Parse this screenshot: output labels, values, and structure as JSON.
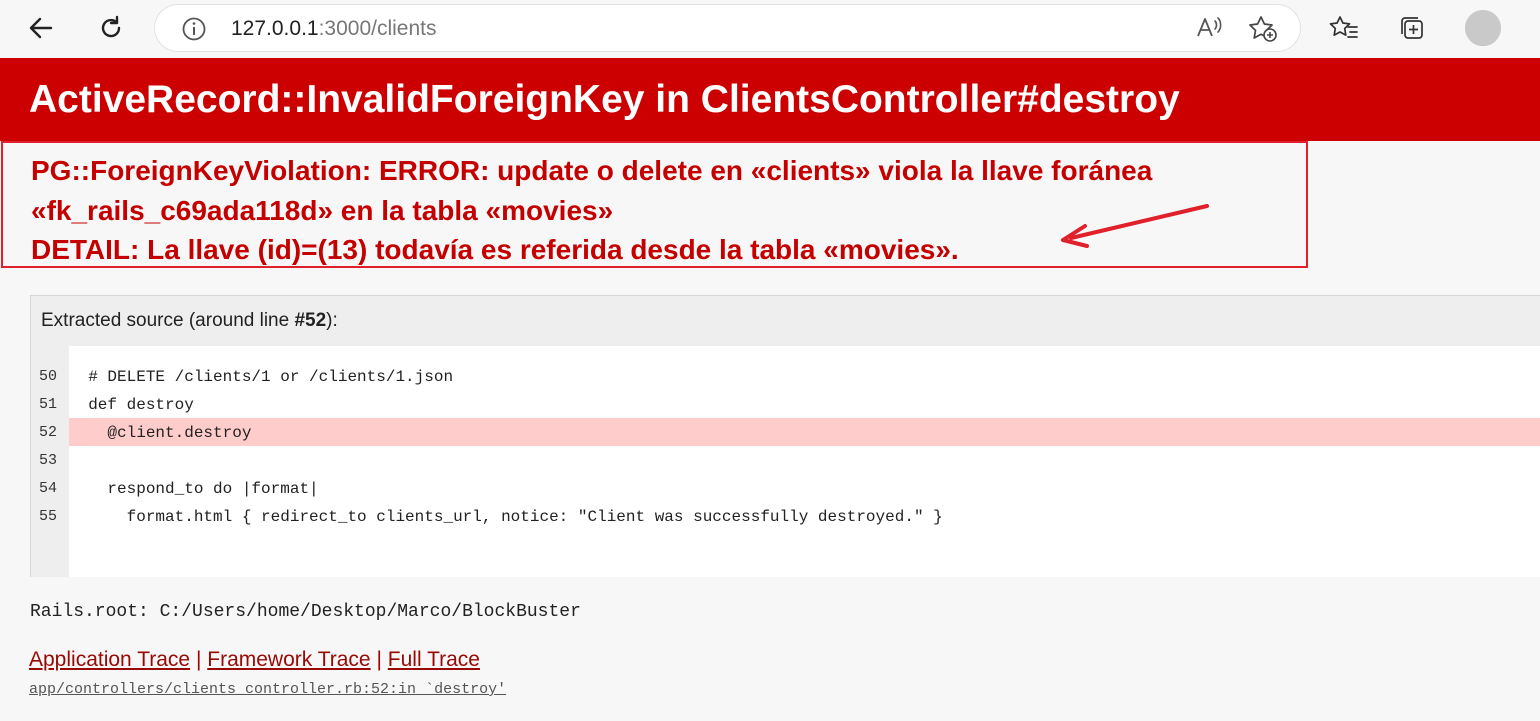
{
  "browser": {
    "url_host": "127.0.0.1",
    "url_rest": ":3000/clients"
  },
  "error": {
    "title": "ActiveRecord::InvalidForeignKey in ClientsController#destroy",
    "message_lines": [
      "PG::ForeignKeyViolation: ERROR: update o delete en «clients» viola la llave foránea",
      "«fk_rails_c69ada118d» en la tabla «movies»",
      "DETAIL: La llave (id)=(13) todavía es referida desde la tabla «movies»."
    ]
  },
  "source": {
    "title_prefix": "Extracted source (around line ",
    "title_line": "#52",
    "title_suffix": "):",
    "lines": [
      {
        "num": "50",
        "code": "  # DELETE /clients/1 or /clients/1.json",
        "highlight": false
      },
      {
        "num": "51",
        "code": "  def destroy",
        "highlight": false
      },
      {
        "num": "52",
        "code": "    @client.destroy",
        "highlight": true
      },
      {
        "num": "53",
        "code": "",
        "highlight": false
      },
      {
        "num": "54",
        "code": "    respond_to do |format|",
        "highlight": false
      },
      {
        "num": "55",
        "code": "      format.html { redirect_to clients_url, notice: \"Client was successfully destroyed.\" }",
        "highlight": false
      }
    ]
  },
  "rails_root": "Rails.root: C:/Users/home/Desktop/Marco/BlockBuster",
  "traces": {
    "application": "Application Trace",
    "framework": "Framework Trace",
    "full": "Full Trace",
    "separator": "|",
    "first_line": "app/controllers/clients_controller.rb:52:in `destroy'"
  },
  "colors": {
    "header_bg": "#cc0000",
    "message_text": "#c50000",
    "highlight": "#ffcccc",
    "link": "#980905",
    "annotation": "#e0202a"
  }
}
